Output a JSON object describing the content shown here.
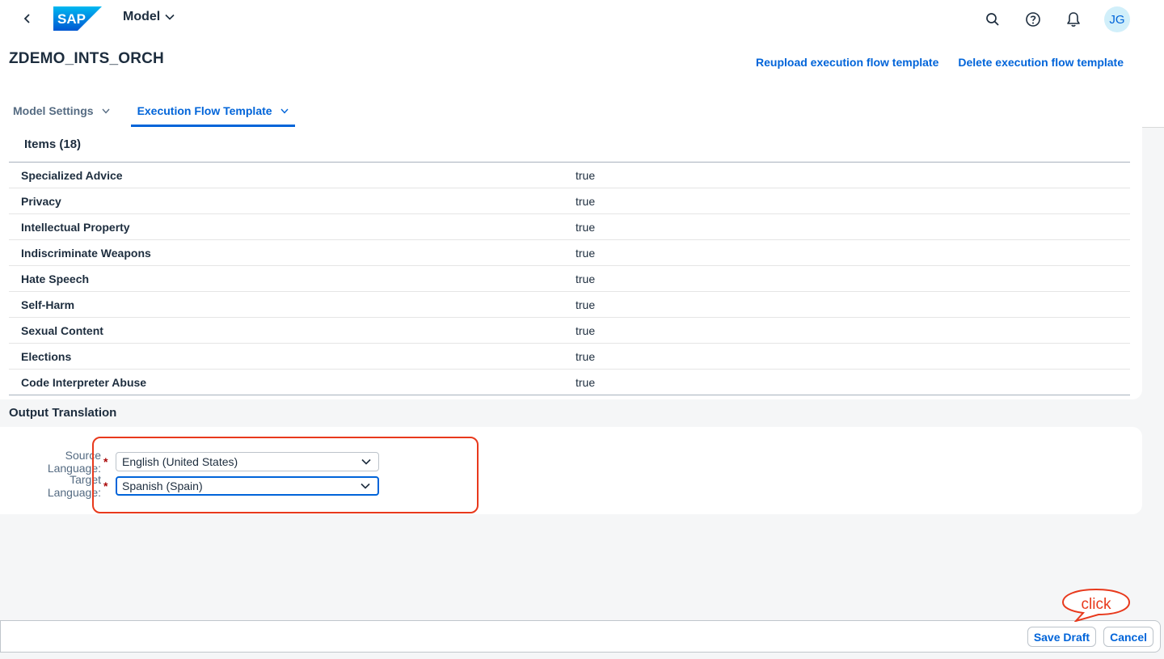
{
  "shellbar": {
    "logo_text": "SAP",
    "app_menu_label": "Model",
    "avatar_initials": "JG",
    "icons": [
      "back-icon",
      "search-icon",
      "help-icon",
      "notification-bell-icon"
    ]
  },
  "header": {
    "title": "ZDEMO_INTS_ORCH",
    "actions": [
      "Reupload execution flow template",
      "Delete execution flow template"
    ],
    "tabs": [
      {
        "label": "Model Settings",
        "active": false
      },
      {
        "label": "Execution Flow Template",
        "active": true
      }
    ]
  },
  "items": {
    "title": "Items (18)",
    "rows": [
      {
        "name": "Specialized Advice",
        "value": "true"
      },
      {
        "name": "Privacy",
        "value": "true"
      },
      {
        "name": "Intellectual Property",
        "value": "true"
      },
      {
        "name": "Indiscriminate Weapons",
        "value": "true"
      },
      {
        "name": "Hate Speech",
        "value": "true"
      },
      {
        "name": "Self-Harm",
        "value": "true"
      },
      {
        "name": "Sexual Content",
        "value": "true"
      },
      {
        "name": "Elections",
        "value": "true"
      },
      {
        "name": "Code Interpreter Abuse",
        "value": "true"
      }
    ]
  },
  "output_translation": {
    "title": "Output Translation",
    "source_label": "Source Language:",
    "source_value": "English (United States)",
    "target_label": "Target Language:",
    "target_value": "Spanish (Spain)",
    "required_marker": "*"
  },
  "footer": {
    "save_draft_label": "Save Draft",
    "cancel_label": "Cancel"
  },
  "annotation": {
    "callout_text": "click",
    "color": "#e8391c"
  },
  "colors": {
    "accent": "#0064d9",
    "text": "#1d2d3e",
    "background": "#f5f6f7",
    "required": "#aa0808"
  }
}
